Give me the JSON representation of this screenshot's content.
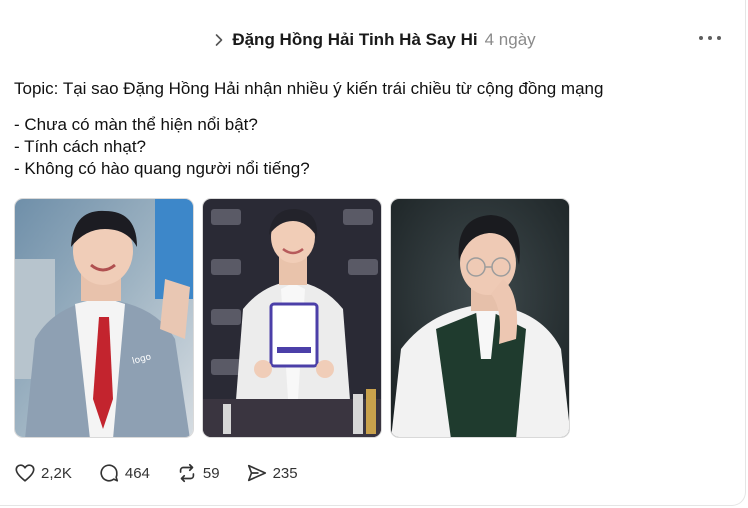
{
  "post": {
    "author": "Đặng Hồng Hải Tinh Hà Say Hi",
    "time": "4 ngày",
    "topic": "Topic: Tại sao Đặng Hồng Hải nhận nhiều ý kiến trái chiều từ cộng đồng mạng",
    "bullets": [
      "- Chưa có màn thể hiện nổi bật?",
      "- Tính cách nhạt?",
      "- Không có hào quang người nổi tiếng?"
    ]
  },
  "actions": {
    "likes": "2,2K",
    "replies": "464",
    "reposts": "59",
    "shares": "235"
  },
  "icons": {
    "header_chevron": "chevron-right-icon",
    "more": "more-horizontal-icon",
    "like": "heart-icon",
    "reply": "comment-bubble-icon",
    "repost": "repost-arrows-icon",
    "share": "send-icon"
  },
  "colors": {
    "text": "#101010",
    "muted": "#8a8a8a",
    "border": "#e5e5e5"
  }
}
